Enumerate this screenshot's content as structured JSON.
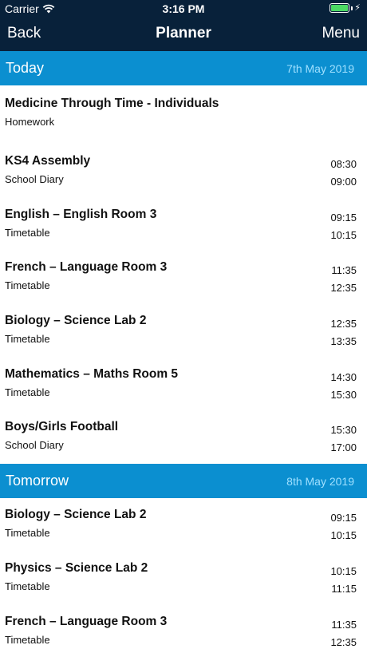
{
  "status_bar": {
    "carrier": "Carrier",
    "time": "3:16 PM"
  },
  "nav": {
    "back_label": "Back",
    "title": "Planner",
    "menu_label": "Menu"
  },
  "sections": [
    {
      "day": "Today",
      "date": "7th May 2019",
      "entries": [
        {
          "title": "Medicine Through Time - Individuals",
          "type": "Homework",
          "start": "",
          "end": ""
        },
        {
          "title": "KS4 Assembly",
          "type": "School Diary",
          "start": "08:30",
          "end": "09:00"
        },
        {
          "title": "English – English Room 3",
          "type": "Timetable",
          "start": "09:15",
          "end": "10:15"
        },
        {
          "title": "French – Language Room 3",
          "type": "Timetable",
          "start": "11:35",
          "end": "12:35"
        },
        {
          "title": "Biology – Science Lab 2",
          "type": "Timetable",
          "start": "12:35",
          "end": "13:35"
        },
        {
          "title": "Mathematics – Maths Room 5",
          "type": "Timetable",
          "start": "14:30",
          "end": "15:30"
        },
        {
          "title": "Boys/Girls Football",
          "type": "School Diary",
          "start": "15:30",
          "end": "17:00"
        }
      ]
    },
    {
      "day": "Tomorrow",
      "date": "8th May 2019",
      "entries": [
        {
          "title": "Biology – Science Lab 2",
          "type": "Timetable",
          "start": "09:15",
          "end": "10:15"
        },
        {
          "title": "Physics – Science Lab 2",
          "type": "Timetable",
          "start": "10:15",
          "end": "11:15"
        },
        {
          "title": "French – Language Room 3",
          "type": "Timetable",
          "start": "11:35",
          "end": "12:35"
        }
      ]
    }
  ],
  "colors": {
    "nav_background": "#08213a",
    "section_header": "#0b8fd0",
    "section_date": "#9fe0ff",
    "battery": "#4cd964"
  }
}
